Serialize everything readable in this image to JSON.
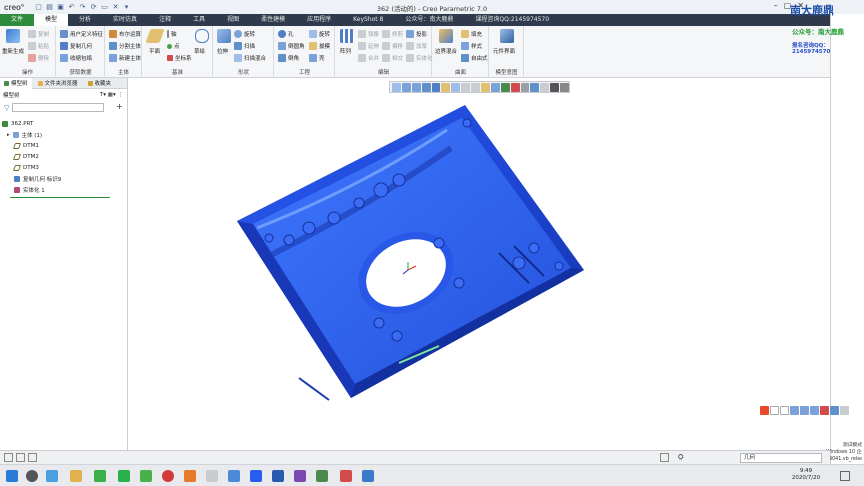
{
  "app": {
    "logo": "creo°",
    "window_title": "362 (活动的) - Creo Parametric 7.0"
  },
  "tabs": [
    {
      "label": "文件"
    },
    {
      "label": "模型"
    },
    {
      "label": "分析"
    },
    {
      "label": "实时仿真"
    },
    {
      "label": "注释"
    },
    {
      "label": "工具"
    },
    {
      "label": "视图"
    },
    {
      "label": "柔性建模"
    },
    {
      "label": "应用程序"
    },
    {
      "label": "KeyShot 8"
    },
    {
      "label": "公众号：南大鹿鼎"
    },
    {
      "label": "课程咨询QQ:2145974570"
    }
  ],
  "ribbon": {
    "groups": [
      {
        "title": "操作"
      },
      {
        "title": "获取数据"
      },
      {
        "title": "主体"
      },
      {
        "title": "基准"
      },
      {
        "title": "形状"
      },
      {
        "title": "工程"
      },
      {
        "title": "编辑"
      },
      {
        "title": "曲面"
      },
      {
        "title": "模型意图"
      }
    ],
    "ops": {
      "regen": "重新生成",
      "copy": "复制",
      "paste": "粘贴",
      "delete": "删除"
    },
    "getdata": {
      "udf": "用户定义特征",
      "copygeom": "复制几何",
      "shrink": "收缩包络"
    },
    "body": {
      "boolean": "布尔运算",
      "split": "分割主体",
      "newbody": "新建主体"
    },
    "datum": {
      "plane": "平面",
      "axis": "轴",
      "point": "点",
      "csys": "坐标系",
      "sketch": "草绘"
    },
    "shape": {
      "extrude": "拉伸",
      "revolve": "旋转",
      "sweep": "扫描",
      "sweptblend": "扫描混合"
    },
    "eng": {
      "hole": "孔",
      "round": "倒圆角",
      "chamfer": "倒角",
      "pattern": "旋转",
      "draft": "拔模",
      "shell": "壳"
    },
    "edit": {
      "pattern": "阵列",
      "mirror": "镜像",
      "extend": "延伸",
      "trim": "修剪",
      "merge": "合并",
      "offset": "偏移",
      "intersect": "相交",
      "thicken": "加厚",
      "solidify": "实体化",
      "project": "投影",
      "wrap": "包络",
      "solidify2": "实体化"
    },
    "surface": {
      "boundary": "边界混合",
      "fill": "填充",
      "style": "样式",
      "freeform": "自由式"
    },
    "intent": {
      "component": "元件界面"
    }
  },
  "left_panel": {
    "tabs": [
      {
        "label": "模型树"
      },
      {
        "label": "文件夹浏览器"
      },
      {
        "label": "收藏夹"
      }
    ],
    "header": "模型树",
    "tree": [
      {
        "label": "362.PRT"
      },
      {
        "label": "主体 (1)"
      },
      {
        "label": "DTM1"
      },
      {
        "label": "DTM2"
      },
      {
        "label": "DTM3"
      },
      {
        "label": "复制几何 标识9"
      },
      {
        "label": "实体化 1"
      }
    ]
  },
  "watermark": {
    "brand": "南大鹿鼎",
    "wechat": "公众号：南大鹿鼎",
    "qq": "报名咨询QQ：2145974570"
  },
  "windows_info": {
    "line1": "测试模式",
    "line2": "Windows 10 企业版",
    "line3": "19041.vb_release.190318-1202"
  },
  "status": {
    "filter": "几何"
  },
  "taskbar": {
    "time": "9:49",
    "date": "2020/7/20"
  }
}
